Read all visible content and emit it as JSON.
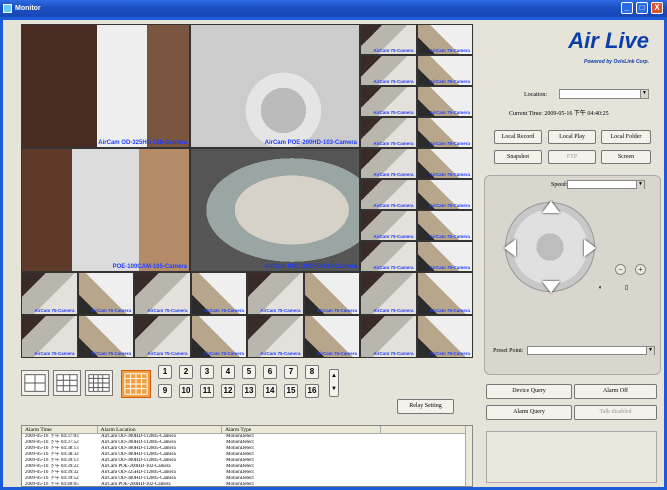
{
  "window": {
    "title": "Monitor",
    "min": "_",
    "max": "□",
    "close": "X"
  },
  "brand": {
    "logo": "Air Live",
    "tagline": "Powered by OvisLink Corp."
  },
  "location": {
    "label": "Location:",
    "value": ""
  },
  "current_time": {
    "label": "Current Time:",
    "value": "2009-05-16 下午 04:40:25"
  },
  "buttons": {
    "local_record": "Local Record",
    "local_play": "Local Play",
    "local_folder": "Local Folder",
    "snapshot": "Snapshot",
    "ftp": "FTP",
    "screen": "Screen",
    "relay_setting": "Relay Setting",
    "device_query": "Device Query",
    "alarm_off": "Alarm Off",
    "alarm_query": "Alarm Query",
    "talk_enabled": "Talk disabled"
  },
  "ptz": {
    "speed_label": "Speed:",
    "speed_value": "",
    "preset_label": "Preset Point:",
    "preset_value": ""
  },
  "cameras": {
    "big": [
      "AirCam OD-325HD-108-Camera",
      "AirCam POE-200HD-103-Camera",
      "POE-100CAM-105-Camera",
      "AirCam POE-200HD-103-Camera"
    ],
    "small_label": "AirCam 75-Camera"
  },
  "channel_buttons": [
    "1",
    "2",
    "3",
    "4",
    "5",
    "6",
    "7",
    "8",
    "9",
    "10",
    "11",
    "12",
    "13",
    "14",
    "15",
    "16"
  ],
  "alarm_table": {
    "columns": [
      "Alarm Time",
      "Alarm Location",
      "Alarm Type",
      ""
    ],
    "rows": [
      [
        "2009-05-16 下午 04:37:03",
        "AirCam OD-300HD-112805-Camera",
        "MotionDetect"
      ],
      [
        "2009-05-16 下午 04:37:52",
        "AirCam OD-300HD-112805-Camera",
        "MotionDetect"
      ],
      [
        "2009-05-16 下午 04:38:13",
        "AirCam OD-300HD-112805-Camera",
        "MotionDetect"
      ],
      [
        "2009-05-16 下午 04:38:32",
        "AirCam OD-300HD-112805-Camera",
        "MotionDetect"
      ],
      [
        "2009-05-16 下午 04:39:13",
        "AirCam OD-300HD-112805-Camera",
        "MotionDetect"
      ],
      [
        "2009-05-16 下午 04:39:22",
        "AirCam POE-200HD-102-Camera",
        "MotionDetect"
      ],
      [
        "2009-05-16 下午 04:39:32",
        "AirCam OD-325HD-112805-Camera",
        "MotionDetect"
      ],
      [
        "2009-05-16 下午 04:39:52",
        "AirCam OD-300HD-112805-Camera",
        "MotionDetect"
      ],
      [
        "2009-05-16 下午 04:40:05",
        "AirCam POE-200HD-102-Camera",
        "MotionDetect"
      ],
      [
        "2009-05-16 下午 04:40:15",
        "AirCam POE-200HD-102-Camera",
        "MotionDetect"
      ]
    ]
  }
}
